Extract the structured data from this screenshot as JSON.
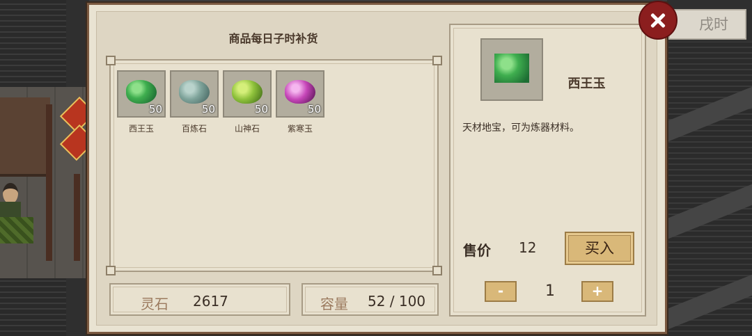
{
  "hud": {
    "time": "戌时"
  },
  "shop": {
    "title": "商品每日子时补货",
    "items": [
      {
        "name": "西王玉",
        "qty": "50",
        "icon": "green-jade-gem-icon",
        "color": "#3fae4f"
      },
      {
        "name": "百炼石",
        "qty": "50",
        "icon": "grey-stone-icon",
        "color": "#7ea39a"
      },
      {
        "name": "山神石",
        "qty": "50",
        "icon": "lime-ore-icon",
        "color": "#8fc23c"
      },
      {
        "name": "紫寒玉",
        "qty": "50",
        "icon": "purple-jade-icon",
        "color": "#c646b8"
      }
    ]
  },
  "footer": {
    "spirit_stone_label": "灵石",
    "spirit_stone_value": "2617",
    "capacity_label": "容量",
    "capacity_value": "52 / 100"
  },
  "detail": {
    "name": "西王玉",
    "icon": "green-jade-gem-icon",
    "description": "天材地宝，可为炼器材料。",
    "price_label": "售价",
    "price_value": "12",
    "buy_label": "买入",
    "minus_label": "-",
    "quantity": "1",
    "plus_label": "+"
  }
}
